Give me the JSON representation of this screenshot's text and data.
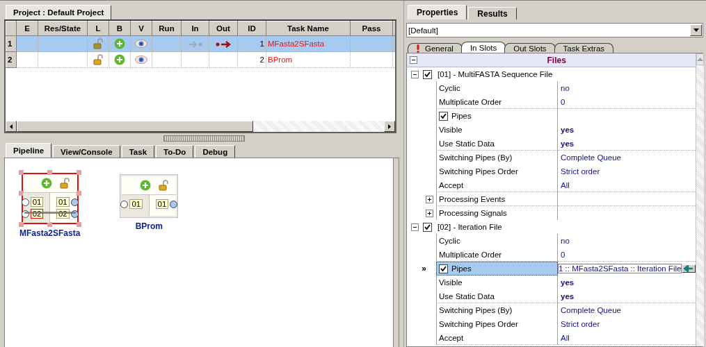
{
  "project_tab": {
    "label": "Project : Default Project",
    "selected": true
  },
  "task_grid": {
    "columns": [
      "E",
      "Res/State",
      "L",
      "B",
      "V",
      "Run",
      "In",
      "Out",
      "ID",
      "Task Name",
      "Pass"
    ],
    "rows": [
      {
        "number": "1",
        "selected": true,
        "locked": false,
        "in_link": true,
        "out_link": true,
        "id": "1",
        "task_name": "MFasta2SFasta"
      },
      {
        "number": "2",
        "selected": false,
        "locked": false,
        "in_link": false,
        "out_link": false,
        "id": "2",
        "task_name": "BProm"
      }
    ]
  },
  "bottom_tabs": [
    {
      "label": "Pipeline",
      "selected": true
    },
    {
      "label": "View/Console",
      "selected": false
    },
    {
      "label": "Task",
      "selected": false
    },
    {
      "label": "To-Do",
      "selected": false
    },
    {
      "label": "Debug",
      "selected": false
    }
  ],
  "pipeline": {
    "nodes": [
      {
        "name": "MFasta2SFasta",
        "selected": true,
        "connected": true,
        "inputs": [
          {
            "label": "01",
            "highlighted": false
          },
          {
            "label": "02",
            "highlighted": true
          }
        ],
        "outputs": [
          {
            "label": "01",
            "highlighted": false
          },
          {
            "label": "02",
            "highlighted": false
          }
        ]
      },
      {
        "name": "BProm",
        "selected": false,
        "connected": false,
        "inputs": [
          {
            "label": "01",
            "highlighted": false
          }
        ],
        "outputs": [
          {
            "label": "01",
            "highlighted": false
          }
        ]
      }
    ]
  },
  "right_tabs": [
    {
      "label": "Properties",
      "selected": true
    },
    {
      "label": "Results",
      "selected": false
    }
  ],
  "preset": {
    "value": "[Default]"
  },
  "property_tabs": [
    {
      "label": "General",
      "selected": false,
      "warning": true
    },
    {
      "label": "In Slots",
      "selected": true,
      "warning": false
    },
    {
      "label": "Out Slots",
      "selected": false,
      "warning": false
    },
    {
      "label": "Task Extras",
      "selected": false,
      "warning": false
    }
  ],
  "property_grid": {
    "category": {
      "label": "Files",
      "expanded": true,
      "children": [
        {
          "label": "[01] - MultiFASTA Sequence File",
          "checked": true,
          "expanded": true,
          "children": [
            {
              "kind": "prop",
              "label": "Cyclic",
              "value": "no",
              "bold": false,
              "divider_after": false
            },
            {
              "kind": "prop",
              "label": "Multiplicate Order",
              "value": "0",
              "bold": false,
              "divider_after": true
            },
            {
              "kind": "check",
              "label": "Pipes",
              "checked": true,
              "selected": false,
              "divider_after": false
            },
            {
              "kind": "prop",
              "label": "Visible",
              "value": "yes",
              "bold": true,
              "divider_after": false
            },
            {
              "kind": "prop",
              "label": "Use Static Data",
              "value": "yes",
              "bold": true,
              "divider_after": true
            },
            {
              "kind": "prop",
              "label": "Switching Pipes (By)",
              "value": "Complete Queue",
              "bold": false,
              "divider_after": false
            },
            {
              "kind": "prop",
              "label": "Switching Pipes Order",
              "value": "Strict order",
              "bold": false,
              "divider_after": false
            },
            {
              "kind": "prop",
              "label": "Accept",
              "value": "All",
              "bold": false,
              "divider_after": true
            },
            {
              "kind": "expander",
              "label": "Processing Events",
              "expanded": false,
              "divider_after": true
            },
            {
              "kind": "expander",
              "label": "Processing Signals",
              "expanded": false,
              "divider_after": false
            }
          ]
        },
        {
          "label": "[02] - Iteration File",
          "checked": true,
          "expanded": true,
          "children": [
            {
              "kind": "prop",
              "label": "Cyclic",
              "value": "no",
              "bold": false,
              "divider_after": false
            },
            {
              "kind": "prop",
              "label": "Multiplicate Order",
              "value": "0",
              "bold": false,
              "divider_after": true
            },
            {
              "kind": "check",
              "label": "Pipes",
              "checked": true,
              "selected": true,
              "marker": "»",
              "value": "1 :: MFasta2SFasta :: Iteration File",
              "divider_after": false
            },
            {
              "kind": "prop",
              "label": "Visible",
              "value": "yes",
              "bold": true,
              "divider_after": false
            },
            {
              "kind": "prop",
              "label": "Use Static Data",
              "value": "yes",
              "bold": true,
              "divider_after": true
            },
            {
              "kind": "prop",
              "label": "Switching Pipes (By)",
              "value": "Complete Queue",
              "bold": false,
              "divider_after": false
            },
            {
              "kind": "prop",
              "label": "Switching Pipes Order",
              "value": "Strict order",
              "bold": false,
              "divider_after": false
            },
            {
              "kind": "prop",
              "label": "Accept",
              "value": "All",
              "bold": false,
              "divider_after": true
            }
          ]
        }
      ]
    }
  }
}
